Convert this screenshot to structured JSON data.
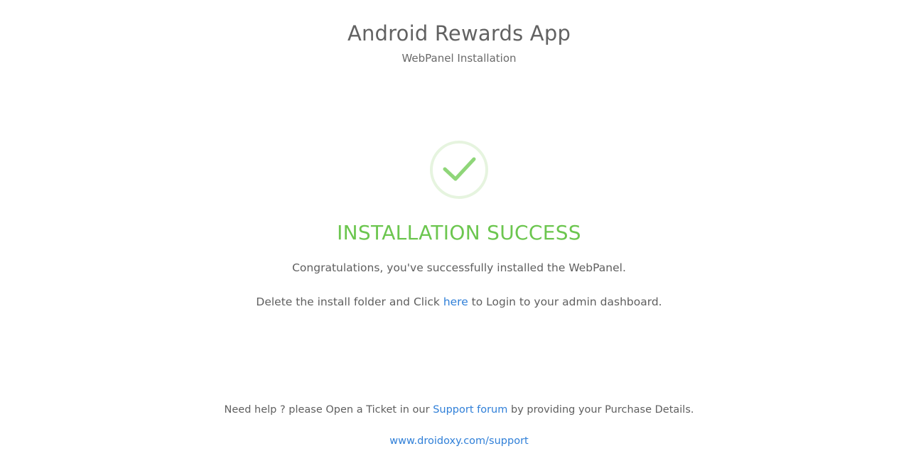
{
  "header": {
    "title": "Android Rewards App",
    "subtitle": "WebPanel Installation"
  },
  "status": {
    "icon": "checkmark-circle-icon",
    "heading": "INSTALLATION SUCCESS",
    "message": "Congratulations, you've successfully installed the WebPanel.",
    "instruction_before": "Delete the install folder and Click ",
    "instruction_link": "here",
    "instruction_after": " to Login to your admin dashboard."
  },
  "footer": {
    "help_before": "Need help ? please Open a Ticket in our ",
    "help_link": "Support forum",
    "help_after": " by providing your Purchase Details.",
    "support_url": "www.droidoxy.com/support"
  },
  "colors": {
    "success": "#6cc64f",
    "check_ring": "#e6f4df",
    "check_mark": "#8fd679",
    "link": "#2f7fd8",
    "text": "#5f5f5f"
  }
}
